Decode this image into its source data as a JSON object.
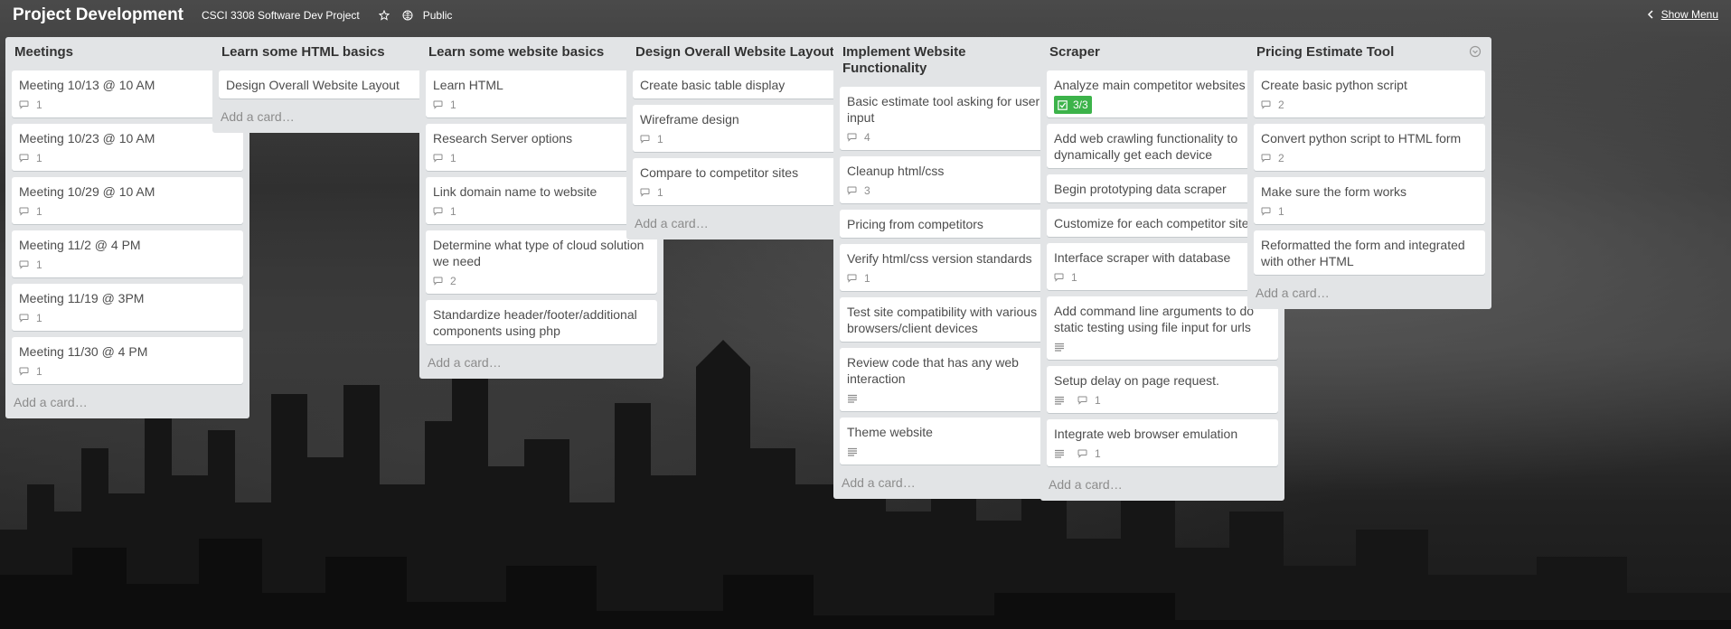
{
  "header": {
    "title": "Project Development",
    "org": "CSCI 3308 Software Dev Project",
    "star_icon": "star-icon",
    "visibility": "Public",
    "show_menu": "Show Menu"
  },
  "lists": [
    {
      "title": "Meetings",
      "add": "Add a card…",
      "cards": [
        {
          "title": "Meeting 10/13 @ 10 AM",
          "comments": "1"
        },
        {
          "title": "Meeting 10/23 @ 10 AM",
          "comments": "1"
        },
        {
          "title": "Meeting 10/29 @ 10 AM",
          "comments": "1"
        },
        {
          "title": "Meeting 11/2 @ 4 PM",
          "comments": "1"
        },
        {
          "title": "Meeting 11/19 @ 3PM",
          "comments": "1"
        },
        {
          "title": "Meeting 11/30 @ 4 PM",
          "comments": "1"
        }
      ]
    },
    {
      "title": "Learn some HTML basics",
      "add": "Add a card…",
      "cards": [
        {
          "title": "Design Overall Website Layout"
        }
      ]
    },
    {
      "title": "Learn some website basics",
      "add": "Add a card…",
      "cards": [
        {
          "title": "Learn HTML",
          "comments": "1"
        },
        {
          "title": "Research Server options",
          "comments": "1"
        },
        {
          "title": "Link domain name to website",
          "comments": "1"
        },
        {
          "title": "Determine what type of cloud solution we need",
          "comments": "2"
        },
        {
          "title": "Standardize header/footer/additional components using php"
        }
      ]
    },
    {
      "title": "Design Overall Website Layout",
      "add": "Add a card…",
      "cards": [
        {
          "title": "Create basic table display"
        },
        {
          "title": "Wireframe design",
          "comments": "1"
        },
        {
          "title": "Compare to competitor sites",
          "comments": "1"
        }
      ]
    },
    {
      "title": "Implement Website Functionality",
      "add": "Add a card…",
      "cards": [
        {
          "title": "Basic estimate tool asking for user input",
          "comments": "4"
        },
        {
          "title": "Cleanup html/css",
          "comments": "3"
        },
        {
          "title": "Pricing from competitors"
        },
        {
          "title": "Verify html/css version standards",
          "comments": "1"
        },
        {
          "title": "Test site compatibility with various browsers/client devices"
        },
        {
          "title": "Review code that has any web interaction",
          "desc": true
        },
        {
          "title": "Theme website",
          "desc": true
        }
      ]
    },
    {
      "title": "Scraper",
      "add": "Add a card…",
      "cards": [
        {
          "title": "Analyze main competitor websites",
          "checklist": "3/3"
        },
        {
          "title": "Add web crawling functionality to dynamically get each device"
        },
        {
          "title": "Begin prototyping data scraper"
        },
        {
          "title": "Customize for each competitor site"
        },
        {
          "title": "Interface scraper with database",
          "comments": "1"
        },
        {
          "title": "Add command line arguments to do static testing using file input for urls",
          "desc": true
        },
        {
          "title": "Setup delay on page request.",
          "desc": true,
          "comments": "1"
        },
        {
          "title": "Integrate web browser emulation",
          "desc": true,
          "comments": "1"
        }
      ]
    },
    {
      "title": "Pricing Estimate Tool",
      "add": "Add a card…",
      "cards": [
        {
          "title": "Create basic python script",
          "comments": "2"
        },
        {
          "title": "Convert python script to HTML form",
          "comments": "2"
        },
        {
          "title": "Make sure the form works",
          "comments": "1"
        },
        {
          "title": "Reformatted the form and integrated with other HTML"
        }
      ]
    }
  ]
}
